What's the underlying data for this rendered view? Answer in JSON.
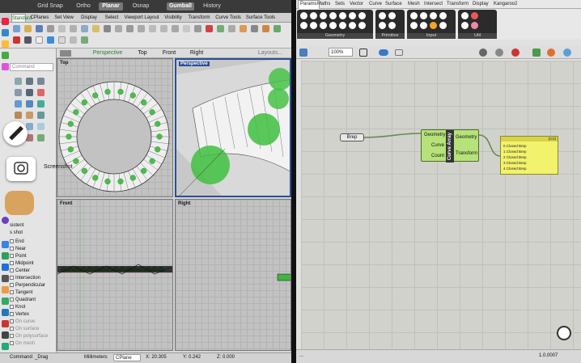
{
  "rhino": {
    "snap_toggles": [
      "Grid Snap",
      "Ortho",
      "Planar",
      "Osnap",
      "Gumball",
      "History"
    ],
    "toolbar_tabs": [
      "Standard",
      "CPlanes",
      "Set View",
      "Display",
      "Select",
      "Viewport Layout",
      "Visibility",
      "Transform",
      "Curve Tools",
      "Surface Tools"
    ],
    "command_placeholder": "Command",
    "viewport_tabs": {
      "perspective": "Perspective",
      "top": "Top",
      "front": "Front",
      "right": "Right",
      "layouts": "Layouts..."
    },
    "viewport_labels": {
      "top": "Top",
      "perspective": "Perspective",
      "front": "Front",
      "right": "Right"
    },
    "screenshot_label": "Screenshot",
    "osnap_partial": [
      "sistent",
      "s shot"
    ],
    "osnap_items": [
      "End",
      "Near",
      "Point",
      "Midpoint",
      "Center",
      "Intersection",
      "Perpendicular",
      "Tangent",
      "Quadrant",
      "Knot",
      "Vertex"
    ],
    "osnap_disabled": [
      "On curve",
      "On surface",
      "On polysurface",
      "On mesh"
    ],
    "status": {
      "command": "Command: _Drag",
      "units": "Millimeters",
      "cplane": "CPlane",
      "x": "X: 20.305",
      "y": "Y: 0.242",
      "z": "Z: 0.000"
    }
  },
  "gh": {
    "tabs": [
      "Params",
      "Maths",
      "Sets",
      "Vector",
      "Curve",
      "Surface",
      "Mesh",
      "Intersect",
      "Transform",
      "Display",
      "Kangaroo2"
    ],
    "groups": [
      "Geometry",
      "Primitive",
      "Input",
      "Util"
    ],
    "zoom": "100%",
    "brep_label": "Brep",
    "component": {
      "name": "Curve Array",
      "inputs": [
        "Geometry",
        "Curve",
        "Count"
      ],
      "outputs": [
        "Geometry",
        "Transform"
      ]
    },
    "panel": {
      "header": "{0;0}",
      "rows": [
        "0 Closed Brep",
        "1 Closed Brep",
        "2 Closed Brep",
        "3 Closed Brep",
        "4 Closed Brep"
      ]
    },
    "status_left": "...",
    "version": "1.0.0007"
  }
}
